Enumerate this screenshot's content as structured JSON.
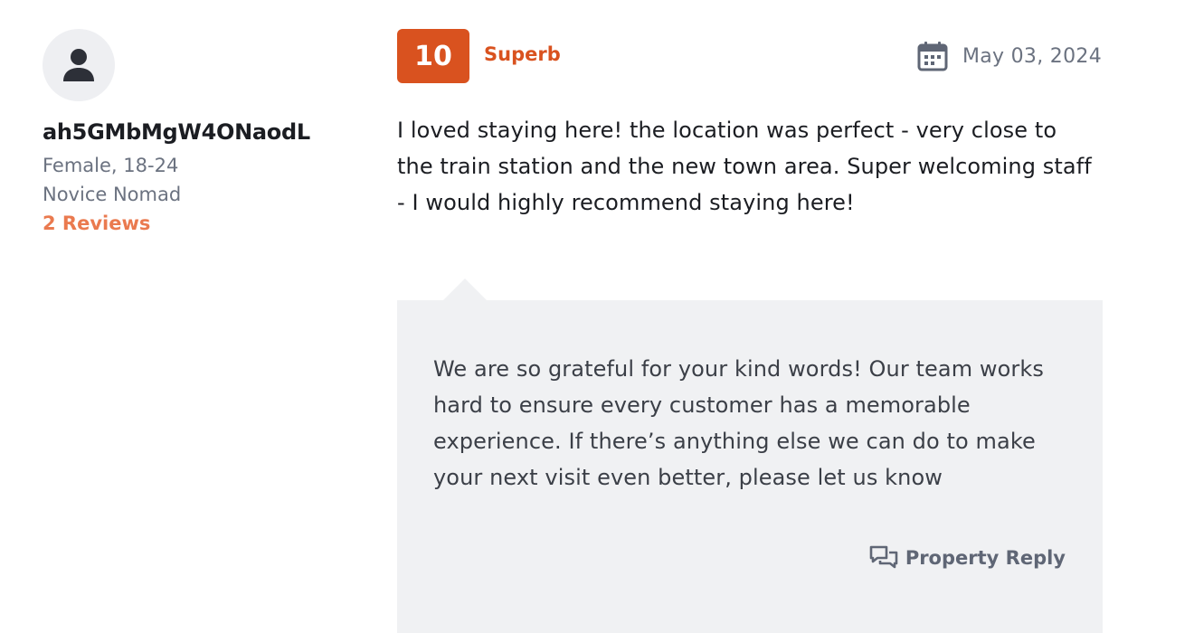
{
  "reviewer": {
    "name": "ah5GMbMgW4ONaodL",
    "demographic": "Female, 18-24",
    "level": "Novice Nomad",
    "reviews_link": "2 Reviews",
    "avatar_icon": "user-icon"
  },
  "rating": {
    "score": "10",
    "label": "Superb",
    "badge_color": "#d9521f"
  },
  "date": {
    "icon": "calendar-icon",
    "text": "May 03, 2024"
  },
  "review": {
    "text": "I loved staying here! the location was perfect - very close to the train station and the new town area. Super welcoming staff - I would highly recommend staying here!"
  },
  "reply": {
    "text": "We are so grateful for your kind words! Our team works hard to ensure every customer has a memorable experience. If there’s anything else we can do to make your next visit even better, please let us know",
    "label": "Property Reply",
    "icon": "chat-bubbles-icon"
  },
  "colors": {
    "accent": "#d9521f",
    "link": "#ea7a4f",
    "muted": "#6b7280",
    "reply_bg": "#f0f1f3"
  }
}
